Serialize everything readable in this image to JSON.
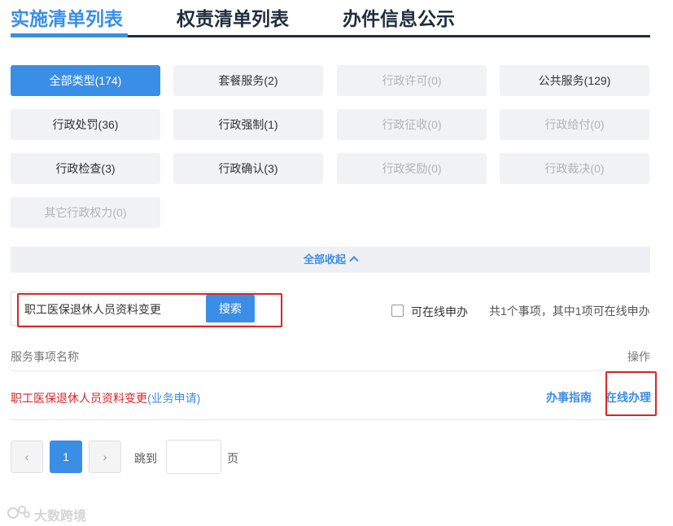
{
  "tabs": [
    {
      "label": "实施清单列表",
      "active": true
    },
    {
      "label": "权责清单列表",
      "active": false
    },
    {
      "label": "办件信息公示",
      "active": false
    }
  ],
  "categories": [
    {
      "label": "全部类型(174)",
      "state": "active"
    },
    {
      "label": "套餐服务(2)",
      "state": "enabled"
    },
    {
      "label": "行政许可(0)",
      "state": "disabled"
    },
    {
      "label": "公共服务(129)",
      "state": "enabled"
    },
    {
      "label": "行政处罚(36)",
      "state": "enabled"
    },
    {
      "label": "行政强制(1)",
      "state": "enabled"
    },
    {
      "label": "行政征收(0)",
      "state": "disabled"
    },
    {
      "label": "行政给付(0)",
      "state": "disabled"
    },
    {
      "label": "行政检查(3)",
      "state": "enabled"
    },
    {
      "label": "行政确认(3)",
      "state": "enabled"
    },
    {
      "label": "行政奖励(0)",
      "state": "disabled"
    },
    {
      "label": "行政裁决(0)",
      "state": "disabled"
    },
    {
      "label": "其它行政权力(0)",
      "state": "disabled"
    }
  ],
  "collapse": {
    "label": "全部收起"
  },
  "search": {
    "value": "职工医保退休人员资料变更",
    "button_label": "搜索"
  },
  "filter": {
    "online_label": "可在线申办",
    "checked": false
  },
  "summary": "共1个事项，其中1项可在线申办",
  "table": {
    "col_name": "服务事项名称",
    "col_op": "操作",
    "rows": [
      {
        "name": "职工医保退休人员资料变更",
        "type": "(业务申请)",
        "guide_label": "办事指南",
        "online_label": "在线办理"
      }
    ]
  },
  "pagination": {
    "prev": "‹",
    "current": "1",
    "next": "›",
    "jump_label": "跳到",
    "page_suffix": "页"
  },
  "watermark": {
    "text": "大数跨境"
  },
  "colors": {
    "accent": "#3a8ee6",
    "highlight_red": "#d9262a",
    "dark": "#1f2d3d"
  }
}
